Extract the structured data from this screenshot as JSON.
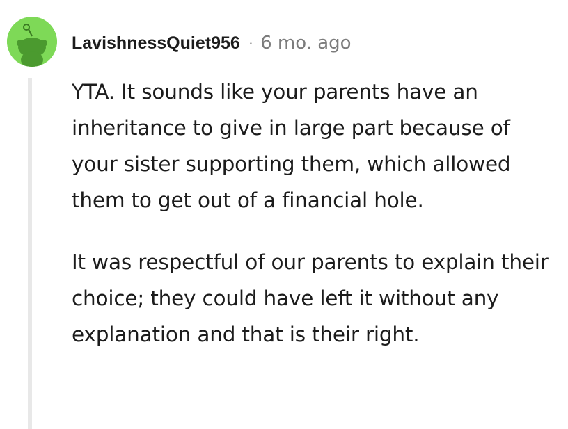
{
  "comment": {
    "username": "LavishnessQuiet956",
    "separator": "·",
    "timestamp": "6 mo. ago",
    "avatar_icon": "snoo-avatar-icon",
    "avatar_color": "#7ed957",
    "paragraphs": [
      "YTA. It sounds like your parents have an inheritance to give in large part because of your sister supporting them, which allowed them to get out of a financial hole.",
      "It was respectful of our parents to explain their choice; they could have left it without any explanation and that is their right."
    ]
  }
}
